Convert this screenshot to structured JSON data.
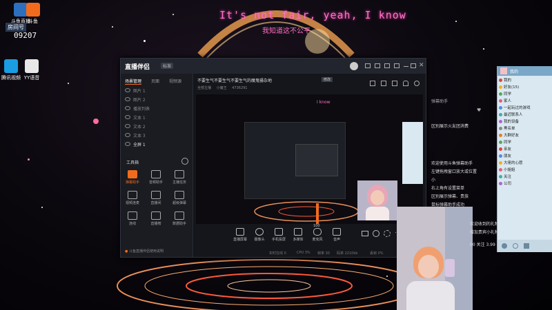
{
  "desktop": {
    "icons": [
      {
        "label": "斗鱼直播",
        "color": "#2d6fbf"
      },
      {
        "label": "斗鱼",
        "color": "#f26b1d"
      },
      {
        "label": "腾讯视频",
        "color": "#1a9de3"
      },
      {
        "label": "YY语音",
        "color": "#e8e8e8"
      }
    ],
    "room_label": "房间号",
    "room_number": "09207",
    "lyric_line": "It's not fair, yeah, I know",
    "lyric_sub": "我知道这不公平"
  },
  "window": {
    "app_name": "直播伴侣",
    "version_badge": "标准",
    "titlebar_icons": [
      "avatar-icon",
      "message-icon",
      "grid-icon",
      "settings-icon",
      "menu-icon",
      "minimize-icon",
      "maximize-icon",
      "close-icon"
    ],
    "side_tabs": [
      "场景管理",
      "页面",
      "视频源"
    ],
    "layers": [
      "图片 1",
      "图片 2",
      "播放列表",
      "文本 1",
      "文本 2",
      "文本 3",
      "全屏 1"
    ],
    "tools_title": "工具箱",
    "tools": [
      {
        "label": "弹幕助手",
        "icon": "danmaku-icon"
      },
      {
        "label": "音频助手",
        "icon": "audio-icon"
      },
      {
        "label": "主播任务",
        "icon": "task-icon"
      },
      {
        "label": "视频连麦",
        "icon": "video-link-icon"
      },
      {
        "label": "直播间",
        "icon": "room-icon"
      },
      {
        "label": "超级弹幕",
        "icon": "super-danmaku-icon"
      },
      {
        "label": "连线",
        "icon": "connect-icon"
      },
      {
        "label": "直播榜",
        "icon": "rank-icon"
      },
      {
        "label": "数据助手",
        "icon": "data-icon"
      }
    ],
    "stream_title": "不要生气不要生气不要生气的魔鬼骚杂地",
    "edit_label": "修改",
    "stream_sub_label": "全部主播",
    "stream_sub_category": "小魔王",
    "stream_id": "4736291",
    "bottom_buttons": [
      {
        "label": "直播屏幕",
        "icon": "screen-icon"
      },
      {
        "label": "摄像头",
        "icon": "camera-icon"
      },
      {
        "label": "手机投屏",
        "icon": "phone-icon"
      },
      {
        "label": "多媒体",
        "icon": "media-icon"
      },
      {
        "label": "麦克风",
        "icon": "mic-icon"
      },
      {
        "label": "音声",
        "icon": "speaker-icon"
      }
    ],
    "volume_value": "100",
    "status_items": [
      "实时在线 0",
      "CPU 3%",
      "帧率 30",
      "码率 2210kb",
      "丢帧 0%"
    ],
    "footer_notice": "斗鱼直播伴侣使用说明"
  },
  "chat": {
    "header": "弹幕助手",
    "lines": [
      "区别展示火友团消费",
      "欢迎使用斗鱼弹幕助手",
      "左键拖拽窗口放大或位置",
      "小",
      "右上角有设置菜单",
      "区别展示弹幕、贵族",
      "鼠标弹幕助手成功",
      "欢迎收到的礼物",
      "增加贵宾小礼物弹幕",
      "00 关注 3.99"
    ]
  },
  "qq": {
    "title": "我的",
    "items": [
      {
        "label": "我的",
        "color": "#e0443a"
      },
      {
        "label": "好友(15)",
        "color": "#f0b020"
      },
      {
        "label": "同学",
        "color": "#55aa55"
      },
      {
        "label": "家人",
        "color": "#e06080"
      },
      {
        "label": "一起玩过的游戏",
        "color": "#5588dd"
      },
      {
        "label": "最近联系人",
        "color": "#44aaaa"
      },
      {
        "label": "我的设备",
        "color": "#aa66cc"
      },
      {
        "label": "黑名单",
        "color": "#888888"
      },
      {
        "label": "大群好友",
        "color": "#e08030"
      },
      {
        "label": "同学",
        "color": "#55aa55"
      },
      {
        "label": "亲友",
        "color": "#e0443a"
      },
      {
        "label": "朋友",
        "color": "#5588dd"
      },
      {
        "label": "大佬的心愿",
        "color": "#f0b020"
      },
      {
        "label": "小姐姐",
        "color": "#e06080"
      },
      {
        "label": "关注",
        "color": "#44aaaa"
      },
      {
        "label": "公司",
        "color": "#aa66cc"
      }
    ]
  },
  "colors": {
    "accent": "#ff72c8",
    "brand_orange": "#f26b1d",
    "window_bg": "#1d1f26",
    "live_button": "#e84d3d"
  }
}
